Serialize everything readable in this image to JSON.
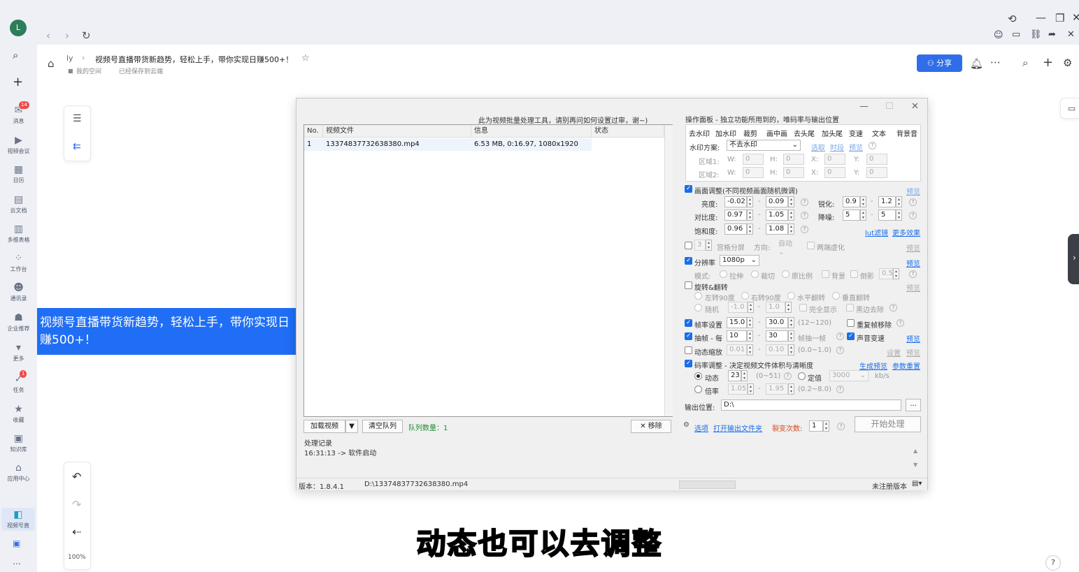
{
  "browser": {
    "avatar_letter": "L"
  },
  "rail": {
    "items": [
      {
        "label": "消息",
        "badge": "14"
      },
      {
        "label": "视频会议",
        "badge": ""
      },
      {
        "label": "日历",
        "badge": ""
      },
      {
        "label": "云文档",
        "badge": ""
      },
      {
        "label": "多维表格",
        "badge": ""
      },
      {
        "label": "工作台",
        "badge": ""
      },
      {
        "label": "通讯录",
        "badge": ""
      },
      {
        "label": "企业推荐",
        "badge": ""
      },
      {
        "label": "更多",
        "badge": ""
      },
      {
        "label": "任务",
        "badge": "1"
      },
      {
        "label": "收藏",
        "badge": ""
      },
      {
        "label": "知识库",
        "badge": ""
      },
      {
        "label": "应用中心",
        "badge": ""
      },
      {
        "label": "视频号直",
        "badge": ""
      }
    ]
  },
  "doc": {
    "breadcrumb_root": "ly",
    "title": "视频号直播带货新趋势，轻松上手，带你实现日赚500+！",
    "location": "我的空间",
    "save_status": "已经保存到云端",
    "share_label": "分享",
    "zoom": "100%"
  },
  "banner": {
    "text": "视频号直播带货新趋势，轻松上手，带你实现日赚500+！"
  },
  "app": {
    "notice": "此为视频批量处理工具，请别再问如何设置过审，谢~)",
    "table": {
      "headers": [
        "No.",
        "视频文件",
        "信息",
        "状态"
      ],
      "rows": [
        {
          "no": "1",
          "file": "13374837732638380.mp4",
          "info": "6.53 MB, 0:16.97, 1080x1920",
          "status": ""
        }
      ]
    },
    "bottom_buttons": {
      "load": "加载视频",
      "clear": "清空队列",
      "queue_label": "队列数量：1",
      "remove": "移除"
    },
    "log": {
      "title": "处理记录",
      "line": "16:31:13 -> 软件启动"
    },
    "status_bar": {
      "version": "版本：1.8.4.1",
      "path": "D:\\13374837732638380.mp4",
      "reg": "未注册版本"
    },
    "panel": {
      "title": "操作面板 - 独立功能所用到的，唯码率与输出位置",
      "tabs": [
        "去水印",
        "加水印",
        "裁剪",
        "画中画",
        "去头尾",
        "加头尾",
        "变速",
        "文本",
        "背景音"
      ],
      "watermark": {
        "scheme_label": "水印方案:",
        "scheme_value": "不去水印",
        "links": [
          "选取",
          "时段",
          "预览"
        ],
        "area1": "区域1:",
        "area2": "区域2:",
        "w": "W:",
        "h": "H:",
        "x": "X:",
        "y": "Y:",
        "zero": "0"
      },
      "picture": {
        "label": "画面调整(不同视频画面随机微调)",
        "preview": "预览",
        "brightness": "亮度:",
        "b_min": "-0.02",
        "b_max": "0.09",
        "sharpen": "锐化:",
        "s_min": "0.9",
        "s_max": "1.2",
        "contrast": "对比度:",
        "c_min": "0.97",
        "c_max": "1.05",
        "denoise": "降噪:",
        "d_min": "5",
        "d_max": "5",
        "saturation": "饱和度:",
        "sa_min": "0.96",
        "sa_max": "1.08",
        "filter_link": "lut滤镜",
        "more_link": "更多效果",
        "dash": "-"
      },
      "grid": {
        "value": "3",
        "label": "宫格分屏",
        "dir_label": "方向:",
        "dir_value": "自动",
        "blur": "两端虚化",
        "preview": "预览"
      },
      "resolution": {
        "label": "分辨率",
        "value": "1080p",
        "preview": "预览",
        "mode": "模式:",
        "opts": [
          "拉伸",
          "裁切",
          "原比例",
          "背景",
          "倒影"
        ],
        "reflect_val": "0.5"
      },
      "rotate": {
        "label": "旋转&翻转",
        "preview": "预览",
        "opts": [
          "左转90度",
          "右转90度",
          "水平翻转",
          "垂直翻转"
        ],
        "random": "随机",
        "r_min": "-1.0",
        "r_max": "1.0",
        "full": "完全显示",
        "black": "黑边去除"
      },
      "framerate": {
        "label": "帧率设置",
        "min": "15.0",
        "max": "30.0",
        "range": "(12~120)",
        "dup": "重复帧移除"
      },
      "frame_drop": {
        "label": "抽帧 - 每",
        "min": "10",
        "max": "30",
        "tail": "帧抽一帧",
        "audio": "声音变速",
        "preview": "预览"
      },
      "zoom": {
        "label": "动态缩放",
        "min": "0.01",
        "max": "0.10",
        "range": "(0.0~1.0)",
        "settings": "设置",
        "preview": "预览"
      },
      "bitrate": {
        "label": "码率调整 - 决定视频文件体积与清晰度",
        "gen_link": "生成预览",
        "reset_link": "参数重置",
        "dynamic": "动态",
        "dyn_val": "23",
        "dyn_range": "(0~51)",
        "fixed": "定值",
        "fixed_val": "3000",
        "unit": "kb/s",
        "ratio": "倍率",
        "ratio_min": "1.05",
        "ratio_max": "1.95",
        "ratio_range": "(0.2~8.0)"
      },
      "output": {
        "label": "输出位置:",
        "value": "D:\\",
        "browse": "..."
      },
      "actions": {
        "options": "选项",
        "open_folder": "打开输出文件夹",
        "split_label": "裂变次数:",
        "split_value": "1",
        "start": "开始处理"
      }
    }
  },
  "subtitle": "动态也可以去调整"
}
